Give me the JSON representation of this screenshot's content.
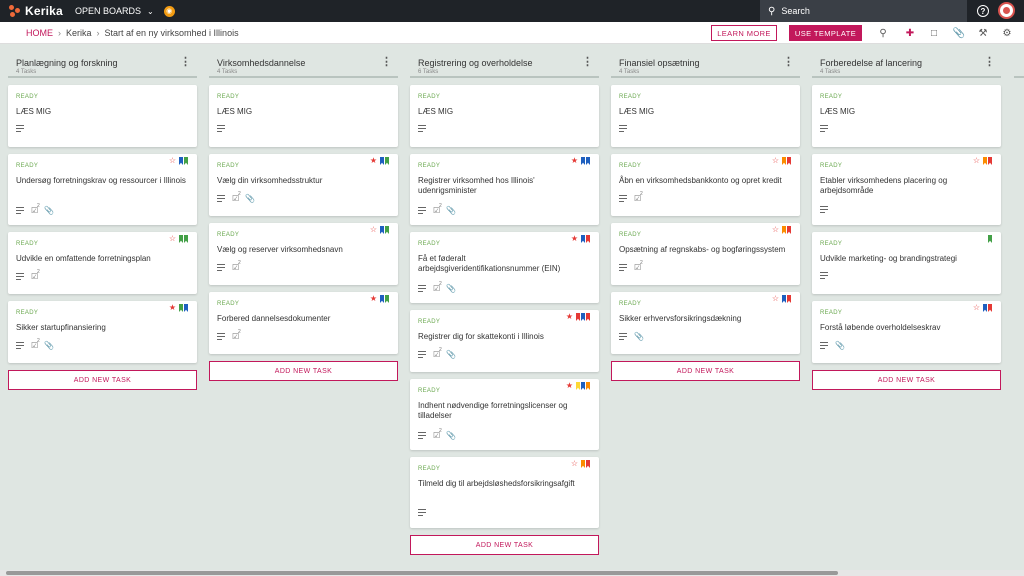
{
  "topbar": {
    "brand": "Kerika",
    "open_boards": "OPEN BOARDS",
    "search_placeholder": "Search",
    "help": "?"
  },
  "breadcrumb": {
    "home": "HOME",
    "workspace": "Kerika",
    "board": "Start af en ny virksomhed i Illinois"
  },
  "actions": {
    "learn_more": "LEARN MORE",
    "use_template": "USE TEMPLATE"
  },
  "colors": {
    "brand": "#c2185b",
    "ready": "#6aa84f",
    "star_red": "#e53935",
    "blue": "#1e5fbf",
    "green": "#43a047",
    "red": "#e53935",
    "orange": "#fb8c00",
    "yellow": "#fdd835"
  },
  "add_task_label": "ADD NEW TASK",
  "columns": [
    {
      "title": "Planlægning og forskning",
      "count": "4 Tasks",
      "cards": [
        {
          "status": "READY",
          "title": "LÆS MIG",
          "star": "none",
          "tags": [],
          "icons": [
            "desc"
          ]
        },
        {
          "status": "READY",
          "title": "Undersøg forretningskrav og ressourcer i Illinois",
          "star": "outline",
          "tags": [
            "blue",
            "green"
          ],
          "icons": [
            "desc",
            "check",
            "clip"
          ],
          "check_count": "2"
        },
        {
          "status": "READY",
          "title": "Udvikle en omfattende forretningsplan",
          "star": "outline",
          "tags": [
            "green",
            "green"
          ],
          "icons": [
            "desc",
            "check"
          ],
          "check_count": "2"
        },
        {
          "status": "READY",
          "title": "Sikker startupfinansiering",
          "star": "filled",
          "tags": [
            "green",
            "blue"
          ],
          "icons": [
            "desc",
            "check",
            "clip"
          ],
          "check_count": "2"
        }
      ]
    },
    {
      "title": "Virksomhedsdannelse",
      "count": "4 Tasks",
      "cards": [
        {
          "status": "READY",
          "title": "LÆS MIG",
          "star": "none",
          "tags": [],
          "icons": [
            "desc"
          ]
        },
        {
          "status": "READY",
          "title": "Vælg din virksomhedsstruktur",
          "star": "filled",
          "tags": [
            "blue",
            "green"
          ],
          "icons": [
            "desc",
            "check",
            "clip"
          ],
          "check_count": "2"
        },
        {
          "status": "READY",
          "title": "Vælg og reserver virksomhedsnavn",
          "star": "outline",
          "tags": [
            "blue",
            "green"
          ],
          "icons": [
            "desc",
            "check"
          ],
          "check_count": "2"
        },
        {
          "status": "READY",
          "title": "Forbered dannelsesdokumenter",
          "star": "filled",
          "tags": [
            "blue",
            "green"
          ],
          "icons": [
            "desc",
            "check"
          ],
          "check_count": "2"
        }
      ]
    },
    {
      "title": "Registrering og overholdelse",
      "count": "6 Tasks",
      "cards": [
        {
          "status": "READY",
          "title": "LÆS MIG",
          "star": "none",
          "tags": [],
          "icons": [
            "desc"
          ]
        },
        {
          "status": "READY",
          "title": "Registrer virksomhed hos Illinois' udenrigsminister",
          "star": "filled",
          "tags": [
            "blue",
            "blue"
          ],
          "icons": [
            "desc",
            "check",
            "clip"
          ],
          "check_count": "2"
        },
        {
          "status": "READY",
          "title": "Få et føderalt arbejdsgiveridentifikationsnummer (EIN)",
          "star": "filled",
          "tags": [
            "blue",
            "red"
          ],
          "icons": [
            "desc",
            "check",
            "clip"
          ],
          "check_count": "2"
        },
        {
          "status": "READY",
          "title": "Registrer dig for skattekonti i Illinois",
          "star": "filled",
          "tags": [
            "red",
            "blue",
            "red"
          ],
          "icons": [
            "desc",
            "check",
            "clip"
          ],
          "check_count": "2"
        },
        {
          "status": "READY",
          "title": "Indhent nødvendige forretningslicenser og tilladelser",
          "star": "filled",
          "tags": [
            "yellow",
            "blue",
            "orange"
          ],
          "icons": [
            "desc",
            "check",
            "clip"
          ],
          "check_count": "2"
        },
        {
          "status": "READY",
          "title": "Tilmeld dig til arbejdsløshedsforsikringsafgift",
          "star": "outline",
          "tags": [
            "orange",
            "red"
          ],
          "icons": [
            "desc"
          ]
        }
      ]
    },
    {
      "title": "Finansiel opsætning",
      "count": "4 Tasks",
      "cards": [
        {
          "status": "READY",
          "title": "LÆS MIG",
          "star": "none",
          "tags": [],
          "icons": [
            "desc"
          ]
        },
        {
          "status": "READY",
          "title": "Åbn en virksomhedsbankkonto og opret kredit",
          "star": "outline",
          "tags": [
            "orange",
            "red"
          ],
          "icons": [
            "desc",
            "check"
          ],
          "check_count": "2"
        },
        {
          "status": "READY",
          "title": "Opsætning af regnskabs- og bogføringssystem",
          "star": "outline",
          "tags": [
            "orange",
            "red"
          ],
          "icons": [
            "desc",
            "check"
          ],
          "check_count": "2"
        },
        {
          "status": "READY",
          "title": "Sikker erhvervsforsikringsdækning",
          "star": "outline",
          "tags": [
            "blue",
            "red"
          ],
          "icons": [
            "desc",
            "clip"
          ]
        }
      ]
    },
    {
      "title": "Forberedelse af lancering",
      "count": "4 Tasks",
      "cards": [
        {
          "status": "READY",
          "title": "LÆS MIG",
          "star": "none",
          "tags": [],
          "icons": [
            "desc"
          ]
        },
        {
          "status": "READY",
          "title": "Etabler virksomhedens placering og arbejdsområde",
          "star": "outline",
          "tags": [
            "orange",
            "red"
          ],
          "icons": [
            "desc"
          ]
        },
        {
          "status": "READY",
          "title": "Udvikle marketing- og brandingstrategi",
          "star": "none",
          "tags": [
            "green"
          ],
          "icons": [
            "desc"
          ]
        },
        {
          "status": "READY",
          "title": "Forstå løbende overholdelseskrav",
          "star": "outline",
          "tags": [
            "blue",
            "red"
          ],
          "icons": [
            "desc",
            "clip"
          ]
        }
      ]
    }
  ]
}
